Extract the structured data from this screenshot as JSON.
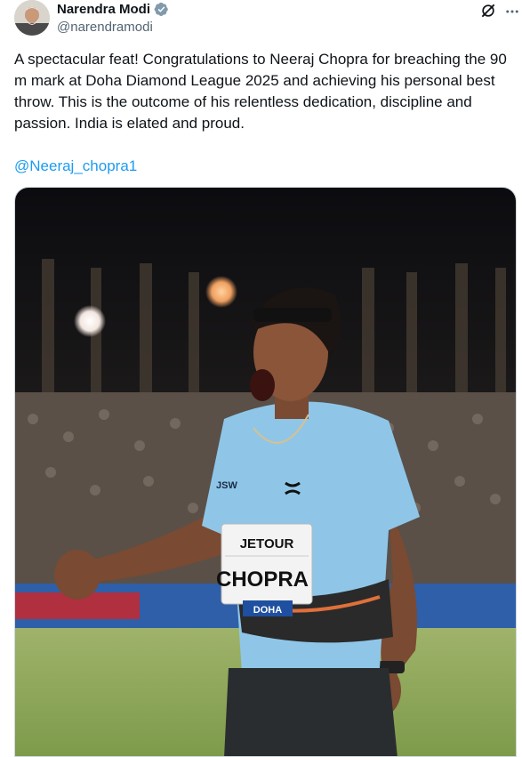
{
  "author": {
    "display_name": "Narendra Modi",
    "handle": "@narendramodi"
  },
  "icons": {
    "avatar": "avatar-image",
    "verified": "verified-badge-icon",
    "grok": "grok-icon",
    "more": "more-options-icon"
  },
  "tweet": {
    "text": "A spectacular feat! Congratulations to Neeraj Chopra for breaching the 90 m mark at Doha Diamond League 2025 and achieving his personal best throw. This is the outcome of his relentless dedication, discipline and passion. India is elated and proud.",
    "mention": "@Neeraj_chopra1"
  },
  "media": {
    "bib_sponsor": "JETOUR",
    "bib_name": "CHOPRA",
    "bib_event": "DOHA",
    "shirt_logo": "JSW"
  },
  "colors": {
    "link": "#1d9bf0",
    "verified": "#829aab",
    "secondary_text": "#536471"
  }
}
